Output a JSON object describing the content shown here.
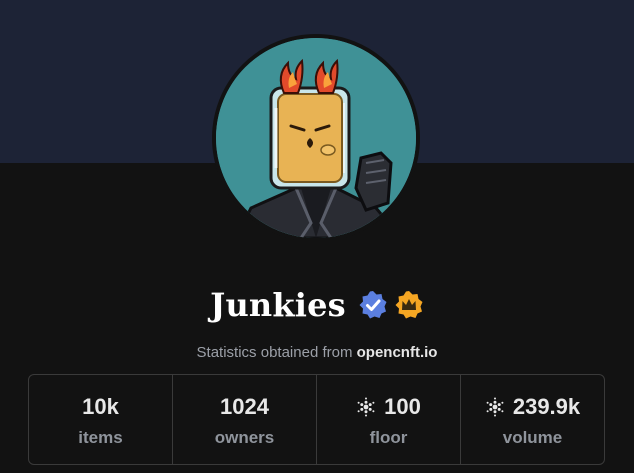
{
  "collection": {
    "name": "Junkies",
    "badges": [
      "verified-badge-icon",
      "crown-badge-icon"
    ]
  },
  "subtitle": {
    "prefix": "Statistics obtained from",
    "source": "opencnft.io"
  },
  "stats": [
    {
      "value": "10k",
      "label": "items",
      "icon": null
    },
    {
      "value": "1024",
      "label": "owners",
      "icon": null
    },
    {
      "value": "100",
      "label": "floor",
      "icon": "cardano-icon"
    },
    {
      "value": "239.9k",
      "label": "volume",
      "icon": "cardano-icon"
    }
  ],
  "colors": {
    "banner": "#1d2336",
    "background": "#121212",
    "avatar_bg": "#3f9196",
    "verified": "#5b7fe0",
    "crown_badge": "#f5a623"
  }
}
